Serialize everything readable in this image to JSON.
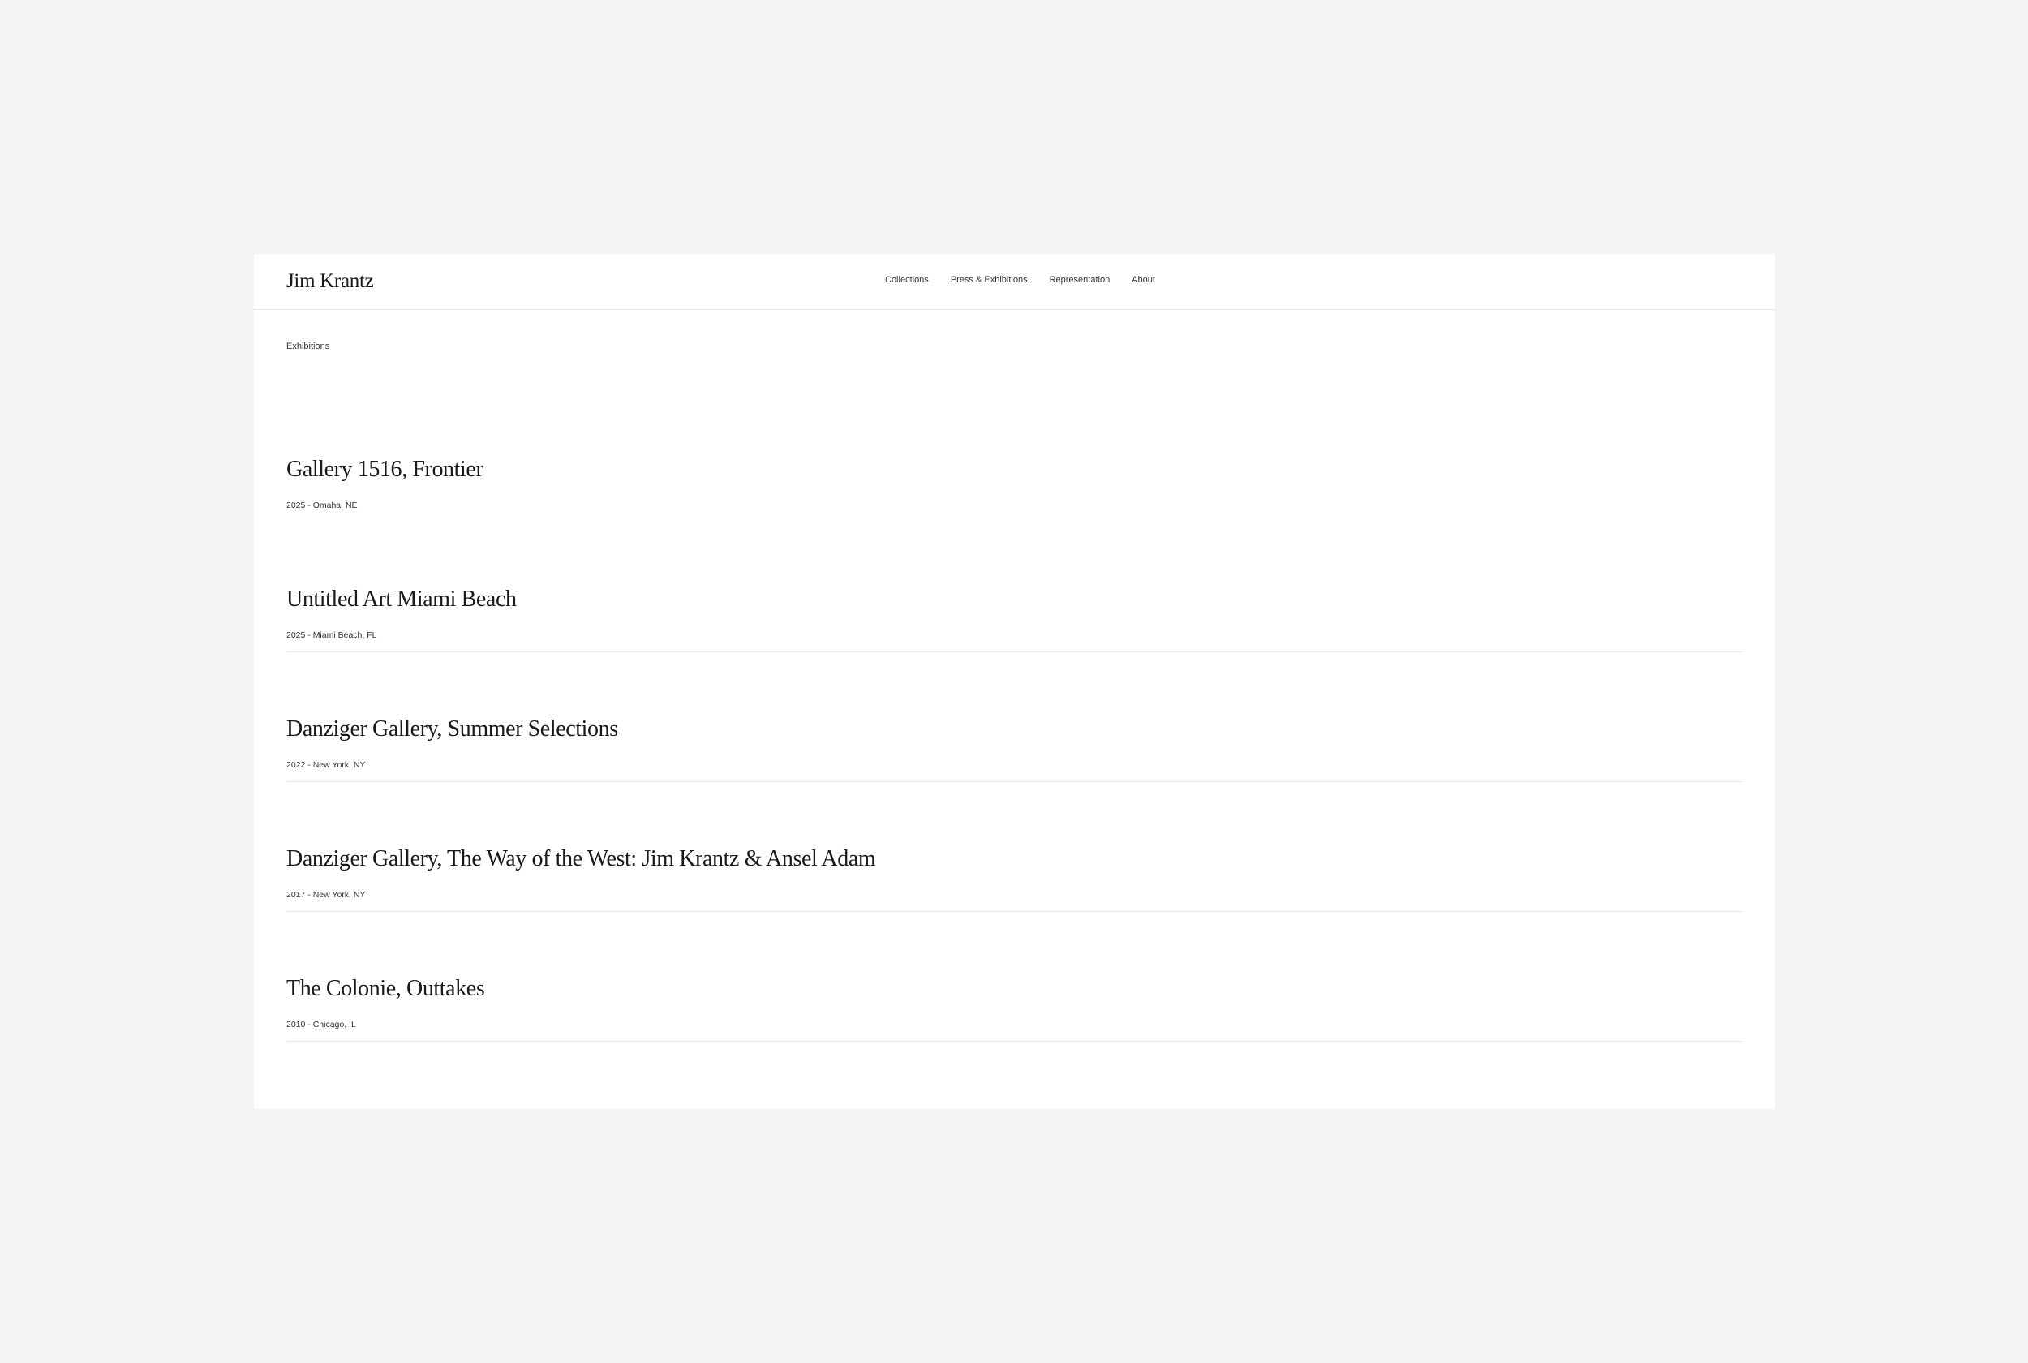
{
  "header": {
    "logo": "Jim Krantz",
    "nav": [
      {
        "label": "Collections"
      },
      {
        "label": "Press & Exhibitions"
      },
      {
        "label": "Representation"
      },
      {
        "label": "About"
      }
    ]
  },
  "section": {
    "label": "Exhibitions"
  },
  "exhibitions": [
    {
      "title": "Gallery 1516, Frontier",
      "meta": "2025 - Omaha, NE"
    },
    {
      "title": "Untitled Art Miami Beach",
      "meta": "2025 - Miami Beach, FL"
    },
    {
      "title": "Danziger Gallery, Summer Selections",
      "meta": "2022 - New York, NY"
    },
    {
      "title": "Danziger Gallery, The Way of the West: Jim Krantz & Ansel Adam",
      "meta": "2017 - New York, NY"
    },
    {
      "title": "The Colonie, Outtakes",
      "meta": "2010 - Chicago, IL"
    }
  ],
  "colors": {
    "background": "#f4f4f4",
    "page": "#ffffff",
    "text": "#1a1a1a",
    "divider": "#e6e6e6"
  }
}
